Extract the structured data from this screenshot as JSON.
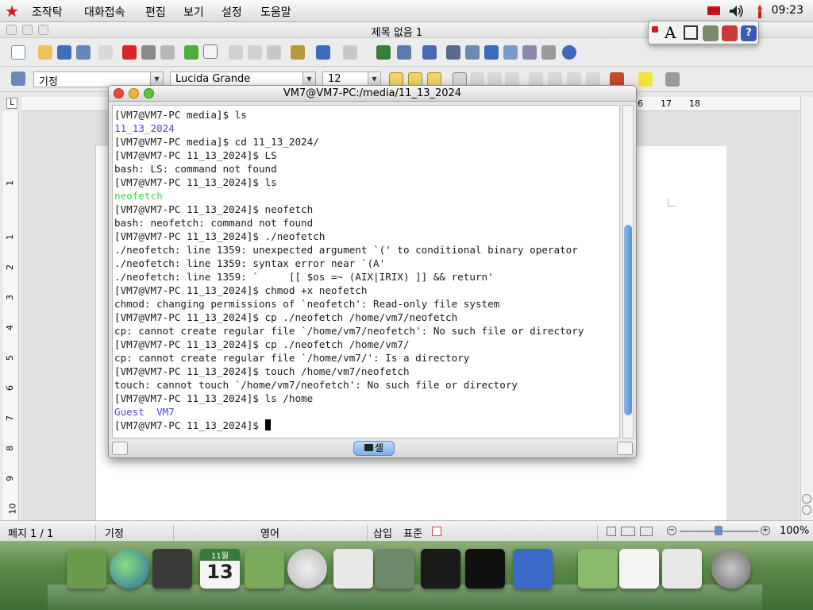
{
  "menubar": {
    "logo": "red-star-icon",
    "menus": [
      "조작탁",
      "대화접속",
      "편집",
      "보기",
      "설정",
      "도움말"
    ],
    "clock": "09:23"
  },
  "writer": {
    "title": "제목 없음 1",
    "style_value": "기정",
    "font_value": "Lucida Grande",
    "size_value": "12",
    "ruler_labels": [
      "16",
      "17",
      "18"
    ],
    "vertical_ruler": [
      "1",
      "1",
      "2",
      "3",
      "4",
      "5",
      "6",
      "7",
      "8",
      "9",
      "10"
    ],
    "status": {
      "page": "페지 1 / 1",
      "style": "기정",
      "language": "영어",
      "insert": "삽입",
      "selection": "표준",
      "zoom": "100%"
    }
  },
  "palette": {
    "letter": "A"
  },
  "terminal": {
    "title": "VM7@VM7-PC:/media/11_13_2024",
    "tab_label": "셸",
    "lines": [
      {
        "text": "[VM7@VM7-PC media]$ ls",
        "style": ""
      },
      {
        "text": "11_13_2024",
        "style": "blue"
      },
      {
        "text": "[VM7@VM7-PC media]$ cd 11_13_2024/",
        "style": ""
      },
      {
        "text": "[VM7@VM7-PC 11_13_2024]$ LS",
        "style": ""
      },
      {
        "text": "bash: LS: command not found",
        "style": ""
      },
      {
        "text": "[VM7@VM7-PC 11_13_2024]$ ls",
        "style": ""
      },
      {
        "text": "neofetch",
        "style": "green"
      },
      {
        "text": "[VM7@VM7-PC 11_13_2024]$ neofetch",
        "style": ""
      },
      {
        "text": "bash: neofetch: command not found",
        "style": ""
      },
      {
        "text": "[VM7@VM7-PC 11_13_2024]$ ./neofetch",
        "style": ""
      },
      {
        "text": "./neofetch: line 1359: unexpected argument `(' to conditional binary operator",
        "style": ""
      },
      {
        "text": "./neofetch: line 1359: syntax error near `(A'",
        "style": ""
      },
      {
        "text": "./neofetch: line 1359: `     [[ $os =~ (AIX|IRIX) ]] && return'",
        "style": ""
      },
      {
        "text": "[VM7@VM7-PC 11_13_2024]$ chmod +x neofetch",
        "style": ""
      },
      {
        "text": "chmod: changing permissions of `neofetch': Read-only file system",
        "style": ""
      },
      {
        "text": "[VM7@VM7-PC 11_13_2024]$ cp ./neofetch /home/vm7/neofetch",
        "style": ""
      },
      {
        "text": "cp: cannot create regular file `/home/vm7/neofetch': No such file or directory",
        "style": ""
      },
      {
        "text": "[VM7@VM7-PC 11_13_2024]$ cp ./neofetch /home/vm7/",
        "style": ""
      },
      {
        "text": "cp: cannot create regular file `/home/vm7/': Is a directory",
        "style": ""
      },
      {
        "text": "[VM7@VM7-PC 11_13_2024]$ touch /home/vm7/neofetch",
        "style": ""
      },
      {
        "text": "touch: cannot touch `/home/vm7/neofetch': No such file or directory",
        "style": ""
      },
      {
        "text": "[VM7@VM7-PC 11_13_2024]$ ls /home",
        "style": ""
      },
      {
        "text": "Guest  VM7",
        "style": "blue"
      }
    ],
    "prompt": "[VM7@VM7-PC 11_13_2024]$ "
  },
  "dock": {
    "calendar_month": "11월",
    "calendar_day": "13"
  }
}
